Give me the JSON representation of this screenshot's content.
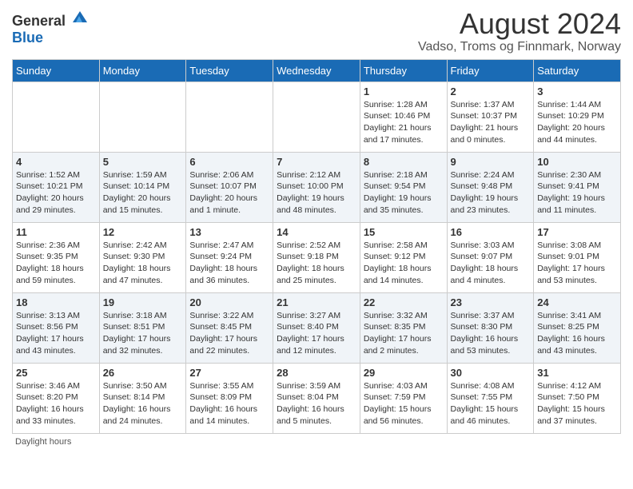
{
  "header": {
    "logo_general": "General",
    "logo_blue": "Blue",
    "title": "August 2024",
    "subtitle": "Vadso, Troms og Finnmark, Norway"
  },
  "calendar": {
    "days_of_week": [
      "Sunday",
      "Monday",
      "Tuesday",
      "Wednesday",
      "Thursday",
      "Friday",
      "Saturday"
    ],
    "weeks": [
      [
        {
          "day": "",
          "info": ""
        },
        {
          "day": "",
          "info": ""
        },
        {
          "day": "",
          "info": ""
        },
        {
          "day": "",
          "info": ""
        },
        {
          "day": "1",
          "info": "Sunrise: 1:28 AM\nSunset: 10:46 PM\nDaylight: 21 hours\nand 17 minutes."
        },
        {
          "day": "2",
          "info": "Sunrise: 1:37 AM\nSunset: 10:37 PM\nDaylight: 21 hours\nand 0 minutes."
        },
        {
          "day": "3",
          "info": "Sunrise: 1:44 AM\nSunset: 10:29 PM\nDaylight: 20 hours\nand 44 minutes."
        }
      ],
      [
        {
          "day": "4",
          "info": "Sunrise: 1:52 AM\nSunset: 10:21 PM\nDaylight: 20 hours\nand 29 minutes."
        },
        {
          "day": "5",
          "info": "Sunrise: 1:59 AM\nSunset: 10:14 PM\nDaylight: 20 hours\nand 15 minutes."
        },
        {
          "day": "6",
          "info": "Sunrise: 2:06 AM\nSunset: 10:07 PM\nDaylight: 20 hours\nand 1 minute."
        },
        {
          "day": "7",
          "info": "Sunrise: 2:12 AM\nSunset: 10:00 PM\nDaylight: 19 hours\nand 48 minutes."
        },
        {
          "day": "8",
          "info": "Sunrise: 2:18 AM\nSunset: 9:54 PM\nDaylight: 19 hours\nand 35 minutes."
        },
        {
          "day": "9",
          "info": "Sunrise: 2:24 AM\nSunset: 9:48 PM\nDaylight: 19 hours\nand 23 minutes."
        },
        {
          "day": "10",
          "info": "Sunrise: 2:30 AM\nSunset: 9:41 PM\nDaylight: 19 hours\nand 11 minutes."
        }
      ],
      [
        {
          "day": "11",
          "info": "Sunrise: 2:36 AM\nSunset: 9:35 PM\nDaylight: 18 hours\nand 59 minutes."
        },
        {
          "day": "12",
          "info": "Sunrise: 2:42 AM\nSunset: 9:30 PM\nDaylight: 18 hours\nand 47 minutes."
        },
        {
          "day": "13",
          "info": "Sunrise: 2:47 AM\nSunset: 9:24 PM\nDaylight: 18 hours\nand 36 minutes."
        },
        {
          "day": "14",
          "info": "Sunrise: 2:52 AM\nSunset: 9:18 PM\nDaylight: 18 hours\nand 25 minutes."
        },
        {
          "day": "15",
          "info": "Sunrise: 2:58 AM\nSunset: 9:12 PM\nDaylight: 18 hours\nand 14 minutes."
        },
        {
          "day": "16",
          "info": "Sunrise: 3:03 AM\nSunset: 9:07 PM\nDaylight: 18 hours\nand 4 minutes."
        },
        {
          "day": "17",
          "info": "Sunrise: 3:08 AM\nSunset: 9:01 PM\nDaylight: 17 hours\nand 53 minutes."
        }
      ],
      [
        {
          "day": "18",
          "info": "Sunrise: 3:13 AM\nSunset: 8:56 PM\nDaylight: 17 hours\nand 43 minutes."
        },
        {
          "day": "19",
          "info": "Sunrise: 3:18 AM\nSunset: 8:51 PM\nDaylight: 17 hours\nand 32 minutes."
        },
        {
          "day": "20",
          "info": "Sunrise: 3:22 AM\nSunset: 8:45 PM\nDaylight: 17 hours\nand 22 minutes."
        },
        {
          "day": "21",
          "info": "Sunrise: 3:27 AM\nSunset: 8:40 PM\nDaylight: 17 hours\nand 12 minutes."
        },
        {
          "day": "22",
          "info": "Sunrise: 3:32 AM\nSunset: 8:35 PM\nDaylight: 17 hours\nand 2 minutes."
        },
        {
          "day": "23",
          "info": "Sunrise: 3:37 AM\nSunset: 8:30 PM\nDaylight: 16 hours\nand 53 minutes."
        },
        {
          "day": "24",
          "info": "Sunrise: 3:41 AM\nSunset: 8:25 PM\nDaylight: 16 hours\nand 43 minutes."
        }
      ],
      [
        {
          "day": "25",
          "info": "Sunrise: 3:46 AM\nSunset: 8:20 PM\nDaylight: 16 hours\nand 33 minutes."
        },
        {
          "day": "26",
          "info": "Sunrise: 3:50 AM\nSunset: 8:14 PM\nDaylight: 16 hours\nand 24 minutes."
        },
        {
          "day": "27",
          "info": "Sunrise: 3:55 AM\nSunset: 8:09 PM\nDaylight: 16 hours\nand 14 minutes."
        },
        {
          "day": "28",
          "info": "Sunrise: 3:59 AM\nSunset: 8:04 PM\nDaylight: 16 hours\nand 5 minutes."
        },
        {
          "day": "29",
          "info": "Sunrise: 4:03 AM\nSunset: 7:59 PM\nDaylight: 15 hours\nand 56 minutes."
        },
        {
          "day": "30",
          "info": "Sunrise: 4:08 AM\nSunset: 7:55 PM\nDaylight: 15 hours\nand 46 minutes."
        },
        {
          "day": "31",
          "info": "Sunrise: 4:12 AM\nSunset: 7:50 PM\nDaylight: 15 hours\nand 37 minutes."
        }
      ]
    ]
  },
  "footer": {
    "daylight_label": "Daylight hours"
  }
}
